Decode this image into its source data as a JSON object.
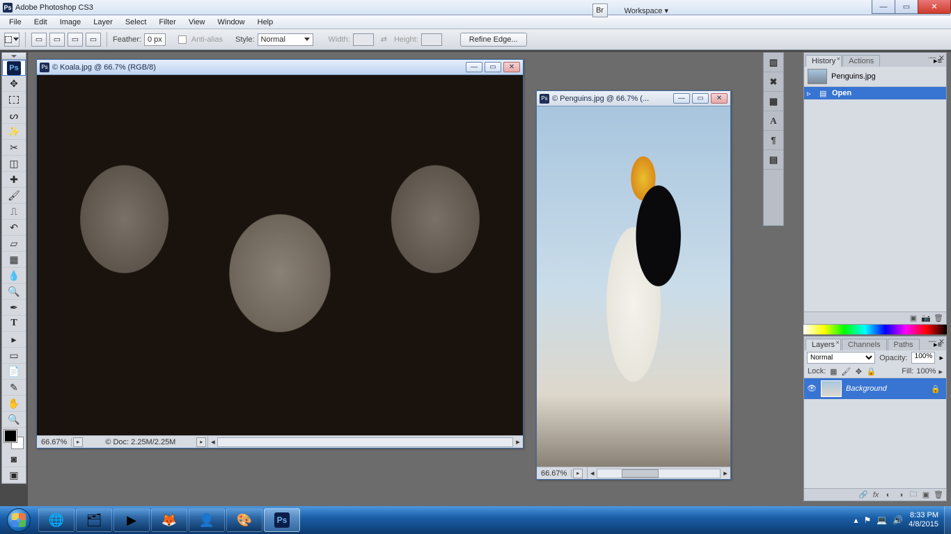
{
  "app": {
    "title": "Adobe Photoshop CS3"
  },
  "menu": [
    "File",
    "Edit",
    "Image",
    "Layer",
    "Select",
    "Filter",
    "View",
    "Window",
    "Help"
  ],
  "options": {
    "feather_label": "Feather:",
    "feather_value": "0 px",
    "antialias_label": "Anti-alias",
    "style_label": "Style:",
    "style_value": "Normal",
    "width_label": "Width:",
    "height_label": "Height:",
    "refine_btn": "Refine Edge...",
    "workspace_btn": "Workspace ▾"
  },
  "doc1": {
    "title": "© Koala.jpg @ 66.7% (RGB/8)",
    "zoom": "66.67%",
    "docinfo": "© Doc: 2.25M/2.25M"
  },
  "doc2": {
    "title": "© Penguins.jpg @ 66.7% (...",
    "zoom": "66.67%"
  },
  "history": {
    "tab_history": "History",
    "tab_actions": "Actions",
    "doc_name": "Penguins.jpg",
    "state": "Open"
  },
  "layers": {
    "tab_layers": "Layers",
    "tab_channels": "Channels",
    "tab_paths": "Paths",
    "blend": "Normal",
    "opacity_label": "Opacity:",
    "opacity_val": "100%",
    "lock_label": "Lock:",
    "fill_label": "Fill:",
    "fill_val": "100%",
    "layer_name": "Background"
  },
  "tray": {
    "time": "8:33 PM",
    "date": "4/8/2015"
  }
}
